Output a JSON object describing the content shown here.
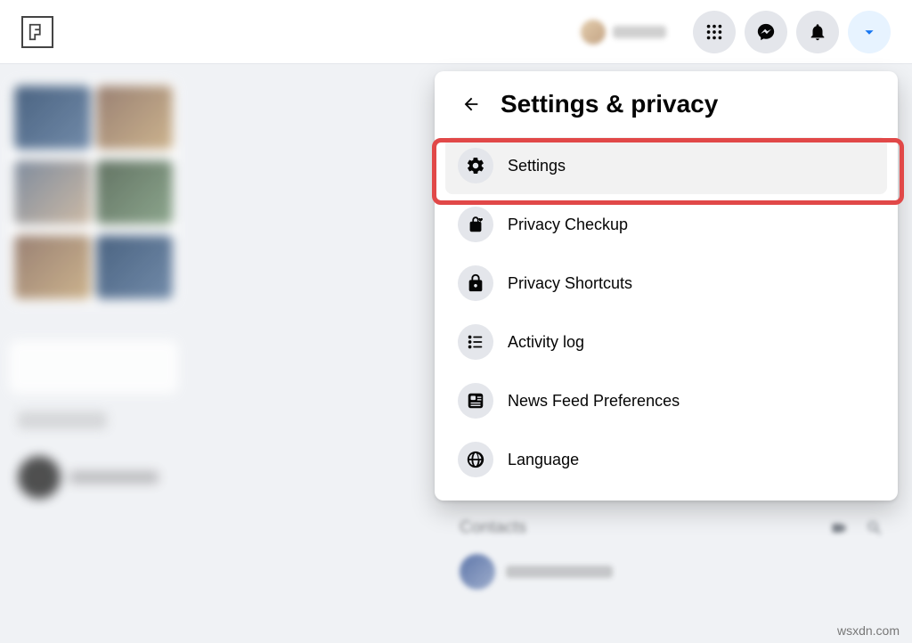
{
  "dropdown": {
    "title": "Settings & privacy",
    "items": [
      {
        "label": "Settings",
        "icon": "gear"
      },
      {
        "label": "Privacy Checkup",
        "icon": "lock-heart"
      },
      {
        "label": "Privacy Shortcuts",
        "icon": "lock"
      },
      {
        "label": "Activity log",
        "icon": "list"
      },
      {
        "label": "News Feed Preferences",
        "icon": "feed"
      },
      {
        "label": "Language",
        "icon": "globe"
      }
    ]
  },
  "contacts": {
    "title": "Contacts"
  },
  "watermark": "wsxdn.com"
}
